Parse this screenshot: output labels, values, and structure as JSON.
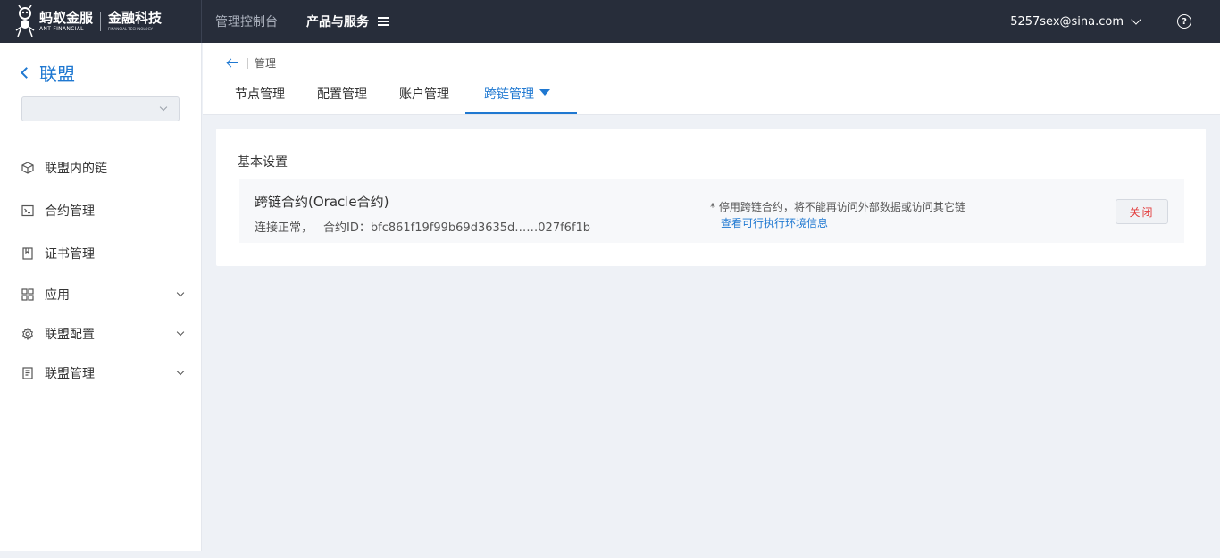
{
  "topbar": {
    "logo_cn": "蚂蚁金服",
    "logo_en": "ANT FINANCIAL",
    "logo_sub_cn": "金融科技",
    "logo_sub_en": "FINANCIAL TECHNOLOGY",
    "nav_console": "管理控制台",
    "nav_products": "产品与服务",
    "user_email": "5257sex@sina.com",
    "help_icon": "?"
  },
  "sidebar": {
    "title": "联盟",
    "select_value": "",
    "items": [
      {
        "label": "联盟内的链",
        "icon": "cube-icon",
        "expandable": false
      },
      {
        "label": "合约管理",
        "icon": "terminal-icon",
        "expandable": false
      },
      {
        "label": "证书管理",
        "icon": "bookmark-icon",
        "expandable": false
      },
      {
        "label": "应用",
        "icon": "grid-icon",
        "expandable": true
      },
      {
        "label": "联盟配置",
        "icon": "gear-icon",
        "expandable": true
      },
      {
        "label": "联盟管理",
        "icon": "document-icon",
        "expandable": true
      }
    ]
  },
  "header": {
    "breadcrumb": "管理",
    "tabs": [
      {
        "label": "节点管理",
        "active": false
      },
      {
        "label": "配置管理",
        "active": false
      },
      {
        "label": "账户管理",
        "active": false
      },
      {
        "label": "跨链管理",
        "active": true
      }
    ]
  },
  "main": {
    "section_title": "基本设置",
    "contract": {
      "name": "跨链合约(Oracle合约)",
      "status": "连接正常，",
      "id_label": "合约ID：",
      "id_value": "bfc861f19f99b69d3635d……027f6f1b",
      "warning": "* 停用跨链合约，将不能再访问外部数据或访问其它链",
      "env_link": "查看可行执行环境信息",
      "close_button": "关闭"
    }
  },
  "colors": {
    "topbar_bg": "#272d3a",
    "accent": "#1f78d1",
    "danger": "#e23b3b",
    "page_bg": "#eef1f6"
  }
}
